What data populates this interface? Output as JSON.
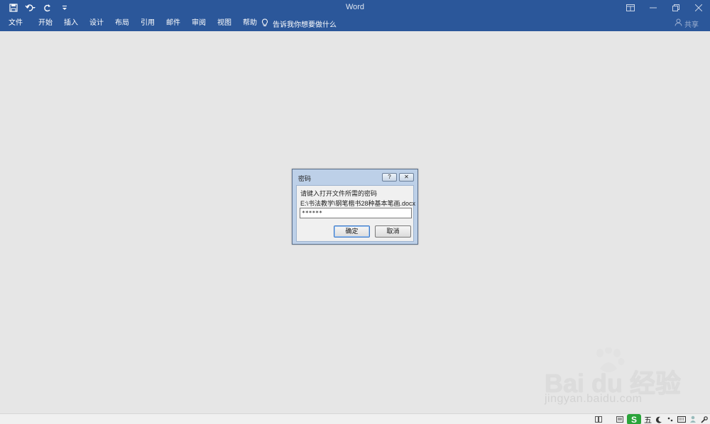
{
  "app": {
    "title": "Word"
  },
  "quick_access": {
    "save_icon": "save-icon",
    "undo_icon": "undo-icon",
    "redo_icon": "redo-icon",
    "customize_icon": "customize-qat-icon"
  },
  "ribbon": {
    "tabs": [
      "文件",
      "开始",
      "插入",
      "设计",
      "布局",
      "引用",
      "邮件",
      "审阅",
      "视图",
      "帮助"
    ],
    "tell_me": "告诉我你想要做什么",
    "share": "共享"
  },
  "dialog": {
    "title": "密码",
    "prompt": "请键入打开文件所需的密码",
    "file_path": "E:\\书法教学\\钢笔楷书28种基本笔画.docx",
    "password_value": "******",
    "ok_label": "确定",
    "cancel_label": "取消",
    "help_glyph": "?",
    "close_glyph": "✕"
  },
  "status_bar": {
    "ime_logo": "S",
    "ime_mode": "五"
  },
  "watermark": {
    "brand": "Bai du 经验",
    "url": "jingyan.baidu.com"
  },
  "colors": {
    "ribbon_blue": "#2b579a",
    "canvas_gray": "#e6e6e6",
    "dialog_frame": "#bdd0e8"
  }
}
